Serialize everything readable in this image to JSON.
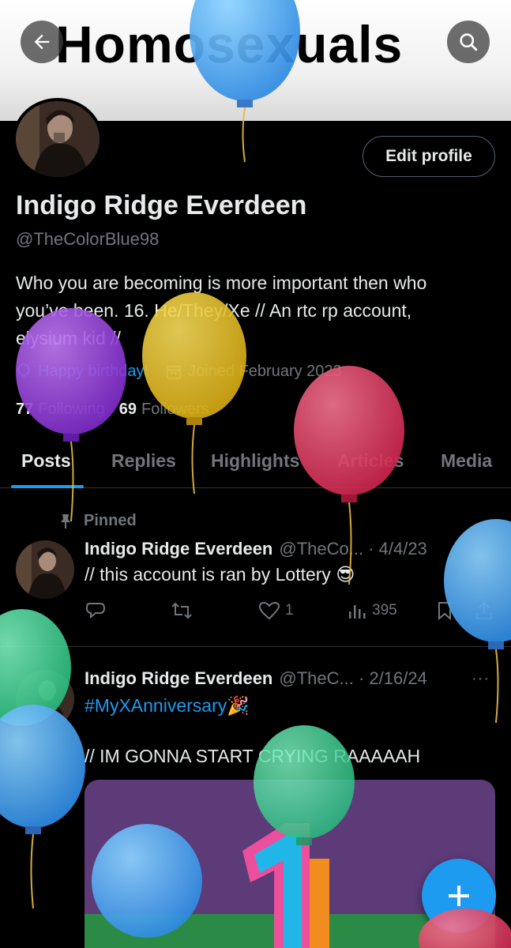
{
  "banner": {
    "text": "Homosexuals"
  },
  "profile": {
    "edit_label": "Edit profile",
    "display_name": "Indigo Ridge Everdeen",
    "handle": "@TheColorBlue98",
    "bio_line1": "Who you are becoming is more important then who",
    "bio_line2": "you’ve been. 16. He/They/Xe // An rtc rp account,",
    "bio_line3": "elysium kid //",
    "birthday": "Happy birthday!",
    "joined": "Joined February 2023",
    "following_count": "77",
    "following_label": "Following",
    "followers_count": "69",
    "followers_label": "Followers"
  },
  "tabs": [
    {
      "label": "Posts"
    },
    {
      "label": "Replies"
    },
    {
      "label": "Highlights"
    },
    {
      "label": "Articles"
    },
    {
      "label": "Media"
    }
  ],
  "posts": [
    {
      "pinned_label": "Pinned",
      "name": "Indigo Ridge Everdeen",
      "handle_date": "@TheCo... · 4/4/23",
      "text": "// this account is ran by Lottery 😎",
      "likes": "1",
      "views": "395"
    },
    {
      "name": "Indigo Ridge Everdeen",
      "handle_date": "@TheC... · 2/16/24",
      "hashtag": "#MyXAnniversary🎉",
      "text": "// IM GONNA START CRYING RAAAAAH"
    }
  ],
  "more_label": "···",
  "colors": {
    "accent": "#1d9bf0",
    "background": "#000000",
    "muted": "#71767b"
  },
  "icons": [
    "back-arrow-icon",
    "search-icon",
    "balloon-icon",
    "calendar-icon",
    "pin-icon",
    "reply-icon",
    "repost-icon",
    "heart-icon",
    "views-icon",
    "bookmark-icon",
    "share-icon",
    "plus-icon"
  ]
}
